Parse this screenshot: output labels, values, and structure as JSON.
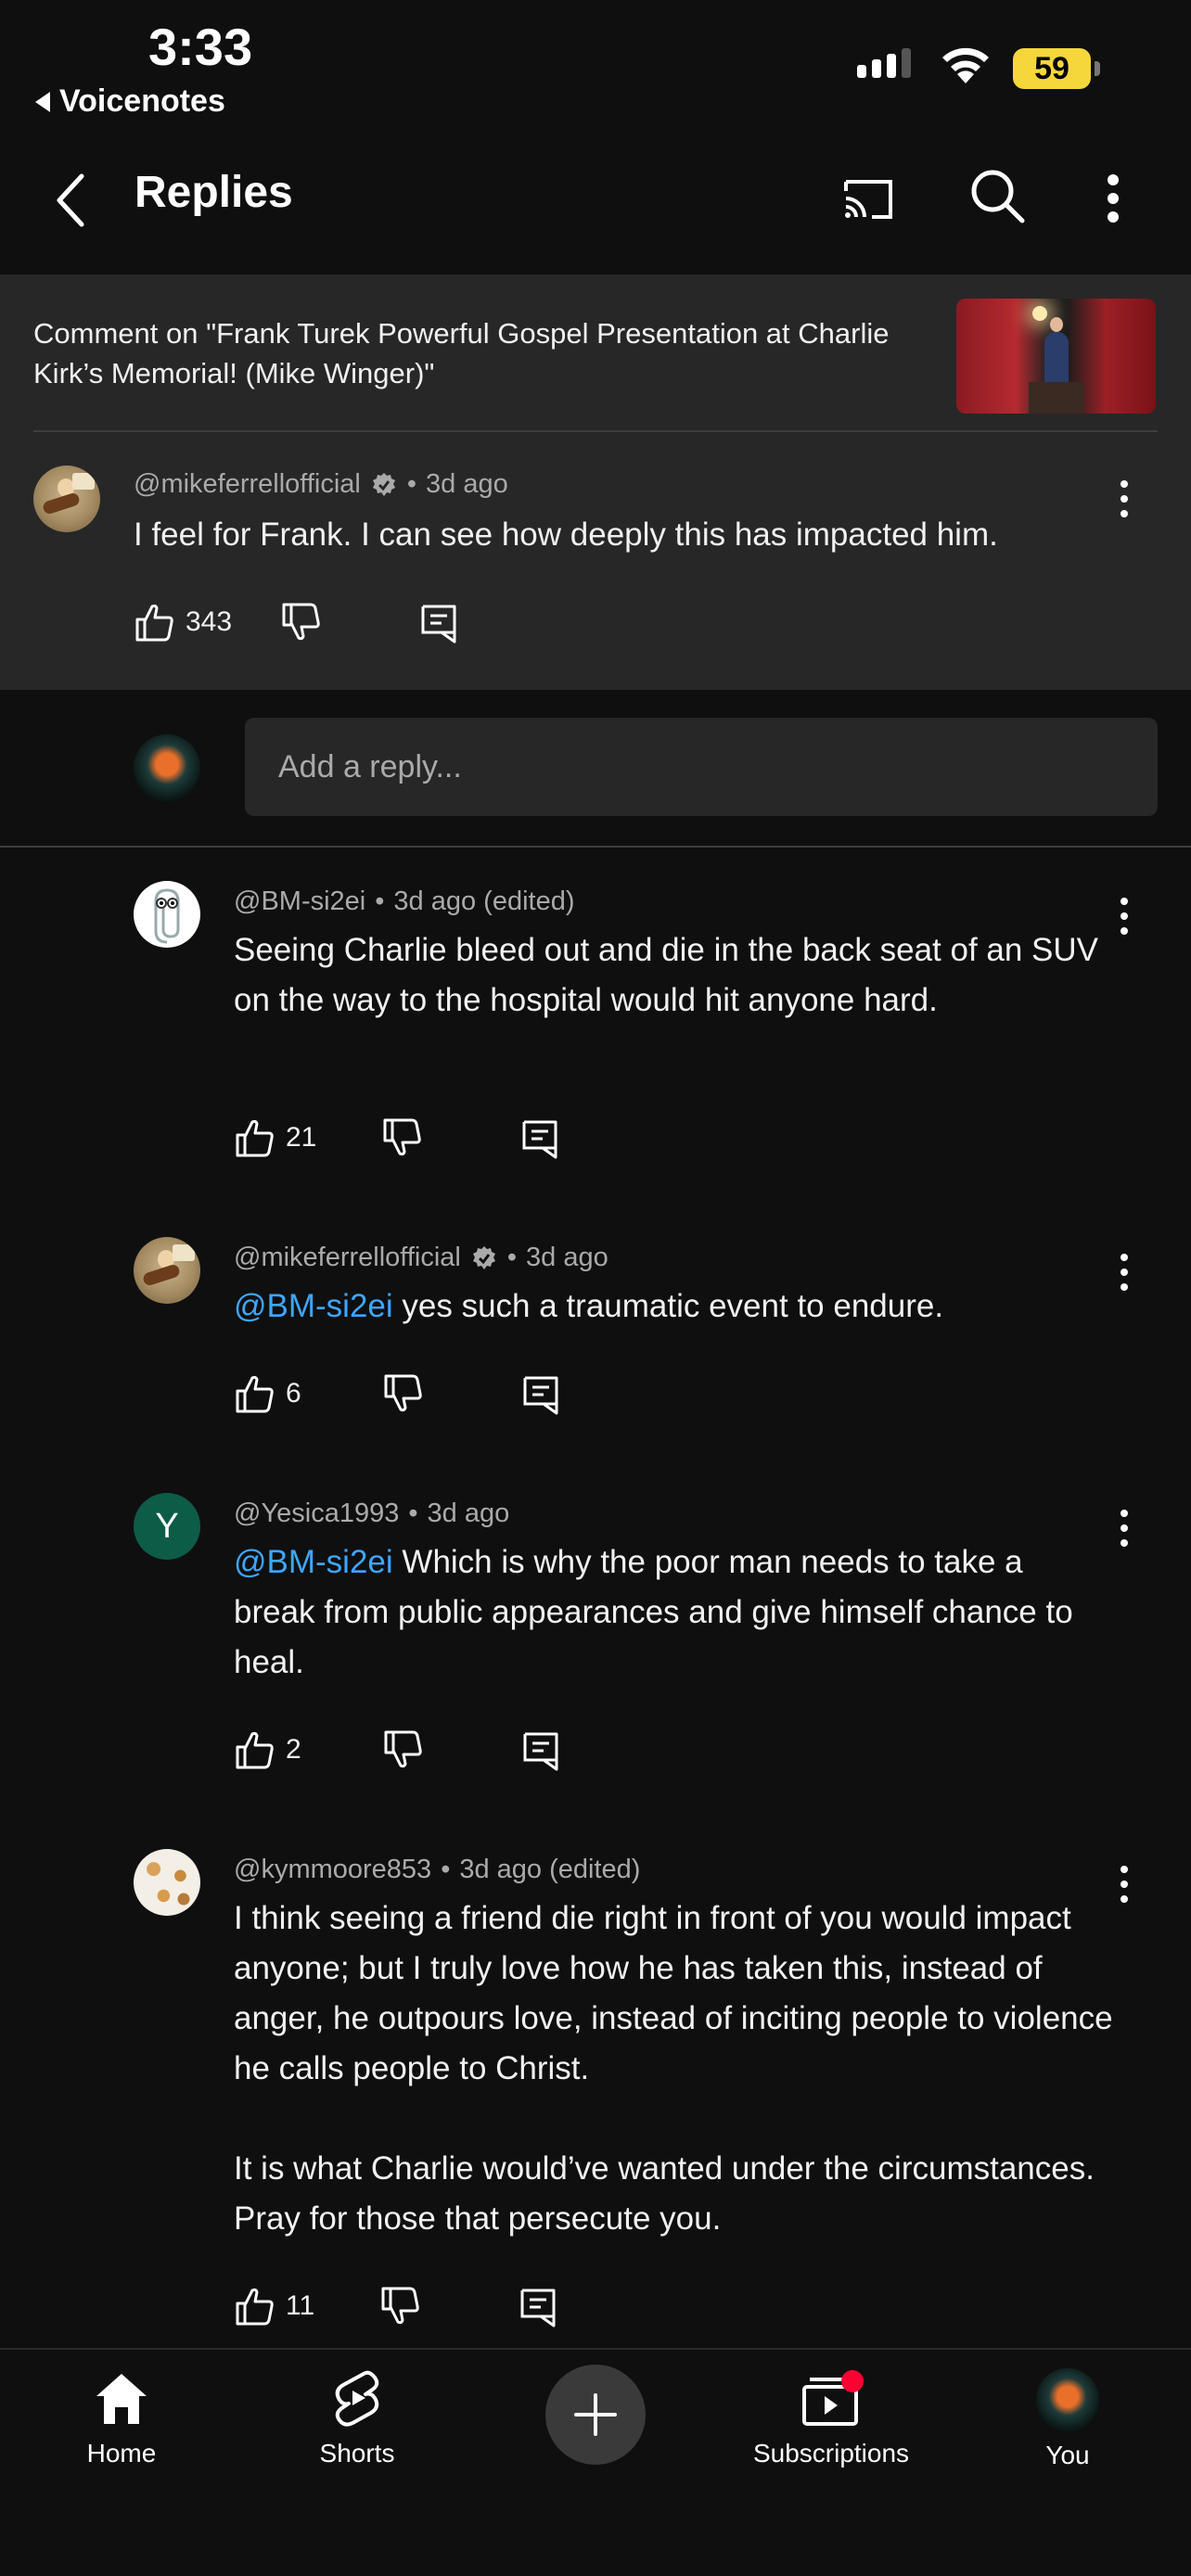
{
  "status_bar": {
    "time": "3:33",
    "back_app": "Voicenotes",
    "battery": "59"
  },
  "header": {
    "title": "Replies"
  },
  "context": {
    "text": "Comment on \"Frank Turek Powerful Gospel Presentation at Charlie Kirk’s Memorial! (Mike Winger)\""
  },
  "parent_comment": {
    "handle": "@mikeferrellofficial",
    "time": "3d ago",
    "text": "I feel for Frank. I can see how deeply this has impacted him.",
    "likes": "343"
  },
  "reply_input": {
    "placeholder": "Add a reply..."
  },
  "replies": [
    {
      "handle": "@BM-si2ei",
      "time": "3d ago (edited)",
      "mention": "",
      "text": "Seeing Charlie bleed out and die in the back seat of an SUV on the way to the hospital would hit anyone hard.",
      "likes": "21"
    },
    {
      "handle": "@mikeferrellofficial",
      "time": "3d ago",
      "mention": "@BM-si2ei",
      "text": "yes such a traumatic event to endure.",
      "likes": "6"
    },
    {
      "handle": "@Yesica1993",
      "time": "3d ago",
      "mention": "@BM-si2ei",
      "text": "Which is why the poor man needs to take a break from public appearances and give himself chance to heal.",
      "likes": "2",
      "avatar_letter": "Y"
    },
    {
      "handle": "@kymmoore853",
      "time": "3d ago (edited)",
      "mention": "",
      "text": "I think seeing a friend die right in front of you would impact anyone; but I truly love how he has taken this, instead of anger, he outpours love, instead of inciting people to violence he calls people to Christ.",
      "text2": "It is what Charlie would’ve wanted under the circumstances. Pray for those that persecute you.",
      "likes": "11"
    }
  ],
  "dot_separator": "•",
  "bottom_nav": {
    "home": "Home",
    "shorts": "Shorts",
    "subscriptions": "Subscriptions",
    "you": "You"
  },
  "colors": {
    "background": "#0f0f0f",
    "surface": "#272727",
    "mention": "#3ea6ff",
    "notification": "#ff0033",
    "battery": "#f5d73b"
  }
}
